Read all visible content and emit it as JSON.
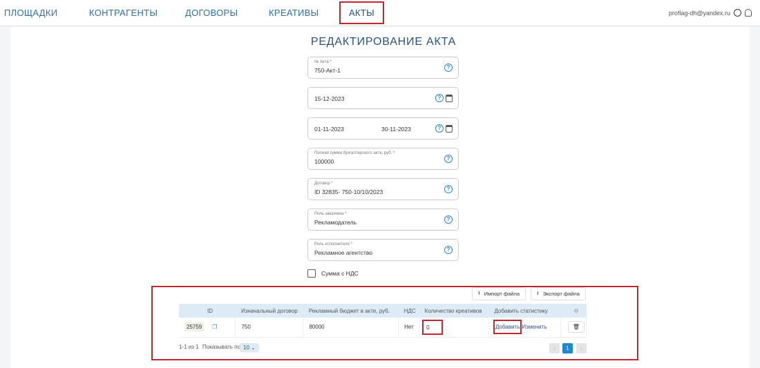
{
  "nav": {
    "items": [
      "ПЛОЩАДКИ",
      "КОНТРАГЕНТЫ",
      "ДОГОВОРЫ",
      "КРЕАТИВЫ",
      "АКТЫ"
    ],
    "user_email": "proflag-dh@yandex.ru"
  },
  "title": "РЕДАКТИРОВАНИЕ АКТА",
  "form": {
    "act_number": {
      "label": "№ Акта *",
      "value": "750-Акт-1"
    },
    "date": {
      "value": "15-12-2023"
    },
    "period": {
      "from": "01-11-2023",
      "to": "30-11-2023"
    },
    "total": {
      "label": "Полная сумма бухгалтерского акта, руб. *",
      "value": "100000"
    },
    "contract": {
      "label": "Договор *",
      "value": "ID 32835- 750-10/10/2023"
    },
    "client_role": {
      "label": "Роль заказчика *",
      "value": "Рекламодатель"
    },
    "contractor_role": {
      "label": "Роль исполнителя *",
      "value": "Рекламное агентство"
    },
    "vat_checkbox": {
      "label": "Сумма с НДС",
      "checked": false
    }
  },
  "toolbar": {
    "import": "Импорт файла",
    "export": "Экспорт файла"
  },
  "table": {
    "headers": [
      "ID",
      "Изначальный договор",
      "Рекламный бюджет в акте, руб.",
      "НДС",
      "Количество креативов",
      "Добавить статистику"
    ],
    "rows": [
      {
        "id": "25759",
        "contract": "750",
        "budget": "80000",
        "vat": "Нет",
        "creatives": "0",
        "add": "Добавить",
        "edit": "Изменить"
      }
    ]
  },
  "pagination": {
    "summary": "1-1 из 1",
    "show_label": "Показывать по",
    "page_size": "10",
    "current_page": "1"
  }
}
